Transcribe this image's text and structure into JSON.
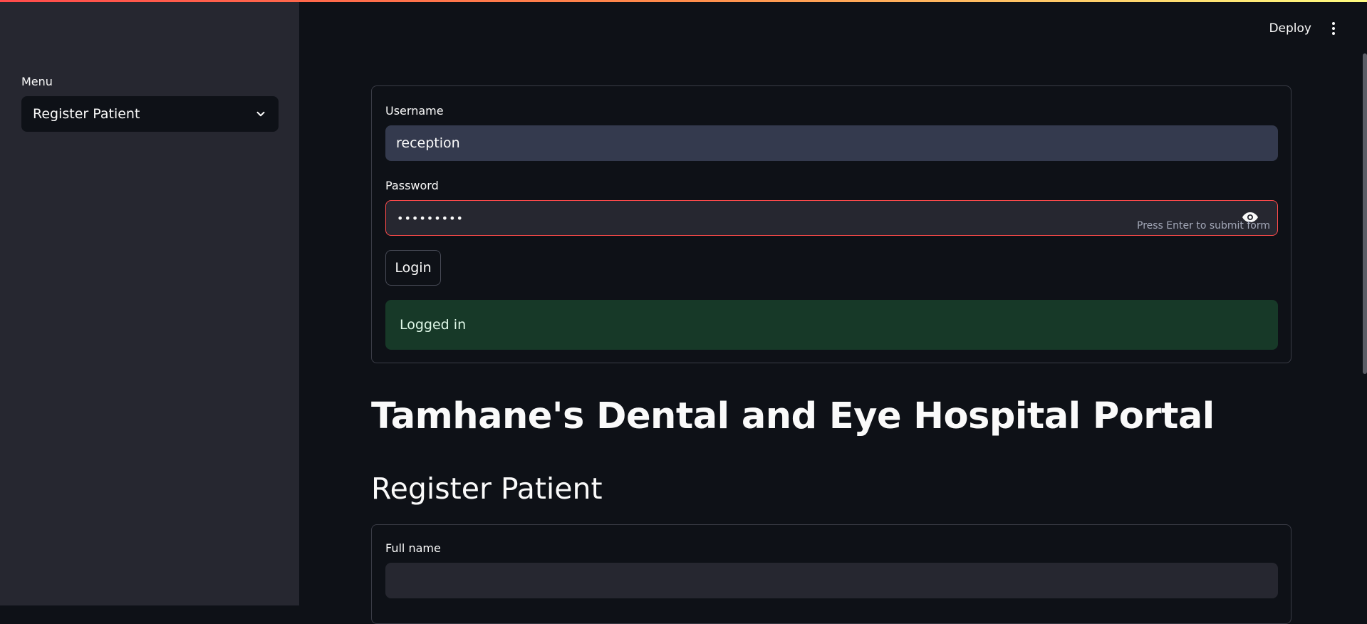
{
  "app": {
    "header": {
      "deploy_label": "Deploy",
      "menu_icon": "kebab-menu-icon"
    },
    "colors": {
      "accent": "#ff4b4b",
      "success_bg": "#173928",
      "sidebar_bg": "#262730",
      "main_bg": "#0e1117"
    }
  },
  "sidebar": {
    "menu_label": "Menu",
    "menu_select": {
      "selected": "Register Patient",
      "icon": "chevron-down-icon"
    }
  },
  "login_form": {
    "username_label": "Username",
    "username_value": "reception",
    "password_label": "Password",
    "password_value": "•••••••••",
    "password_hint": "Press Enter to submit form",
    "password_icon": "eye-icon",
    "login_button": "Login",
    "status_message": "Logged in"
  },
  "page": {
    "title": "Tamhane's Dental and Eye Hospital Portal",
    "section_title": "Register Patient"
  },
  "register_form": {
    "full_name_label": "Full name",
    "full_name_value": ""
  }
}
